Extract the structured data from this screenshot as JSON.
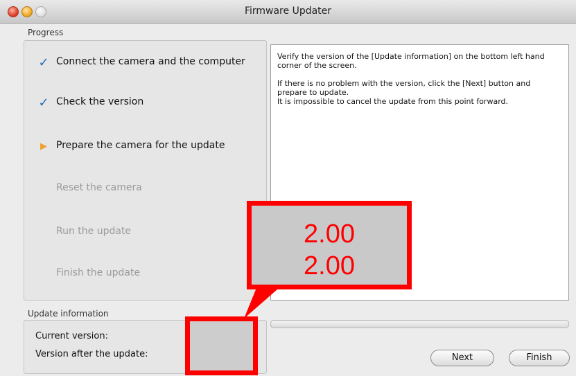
{
  "window": {
    "title": "Firmware Updater"
  },
  "progress": {
    "label": "Progress",
    "steps": [
      {
        "label": "Connect the camera and the computer",
        "status": "done"
      },
      {
        "label": "Check the version",
        "status": "done"
      },
      {
        "label": "Prepare the camera for the update",
        "status": "current"
      },
      {
        "label": "Reset the camera",
        "status": "pending"
      },
      {
        "label": "Run the update",
        "status": "pending"
      },
      {
        "label": "Finish the update",
        "status": "pending"
      }
    ]
  },
  "info": {
    "paragraph1": "Verify the version of the [Update information] on the bottom left hand\ncorner of the screen.",
    "paragraph2": "If there is no problem with the version, click the [Next] button and\nprepare to update.\nIt is impossible to cancel the update from this point forward."
  },
  "update_info": {
    "label": "Update information",
    "current_version_label": "Current version:",
    "after_update_label": "Version after the update:"
  },
  "callout": {
    "current_version": "2.00",
    "after_version": "2.00",
    "color": "#ff0000"
  },
  "buttons": {
    "next": "Next",
    "finish": "Finish"
  },
  "icons": {
    "done": "check-icon",
    "current": "arrow-right-icon"
  }
}
